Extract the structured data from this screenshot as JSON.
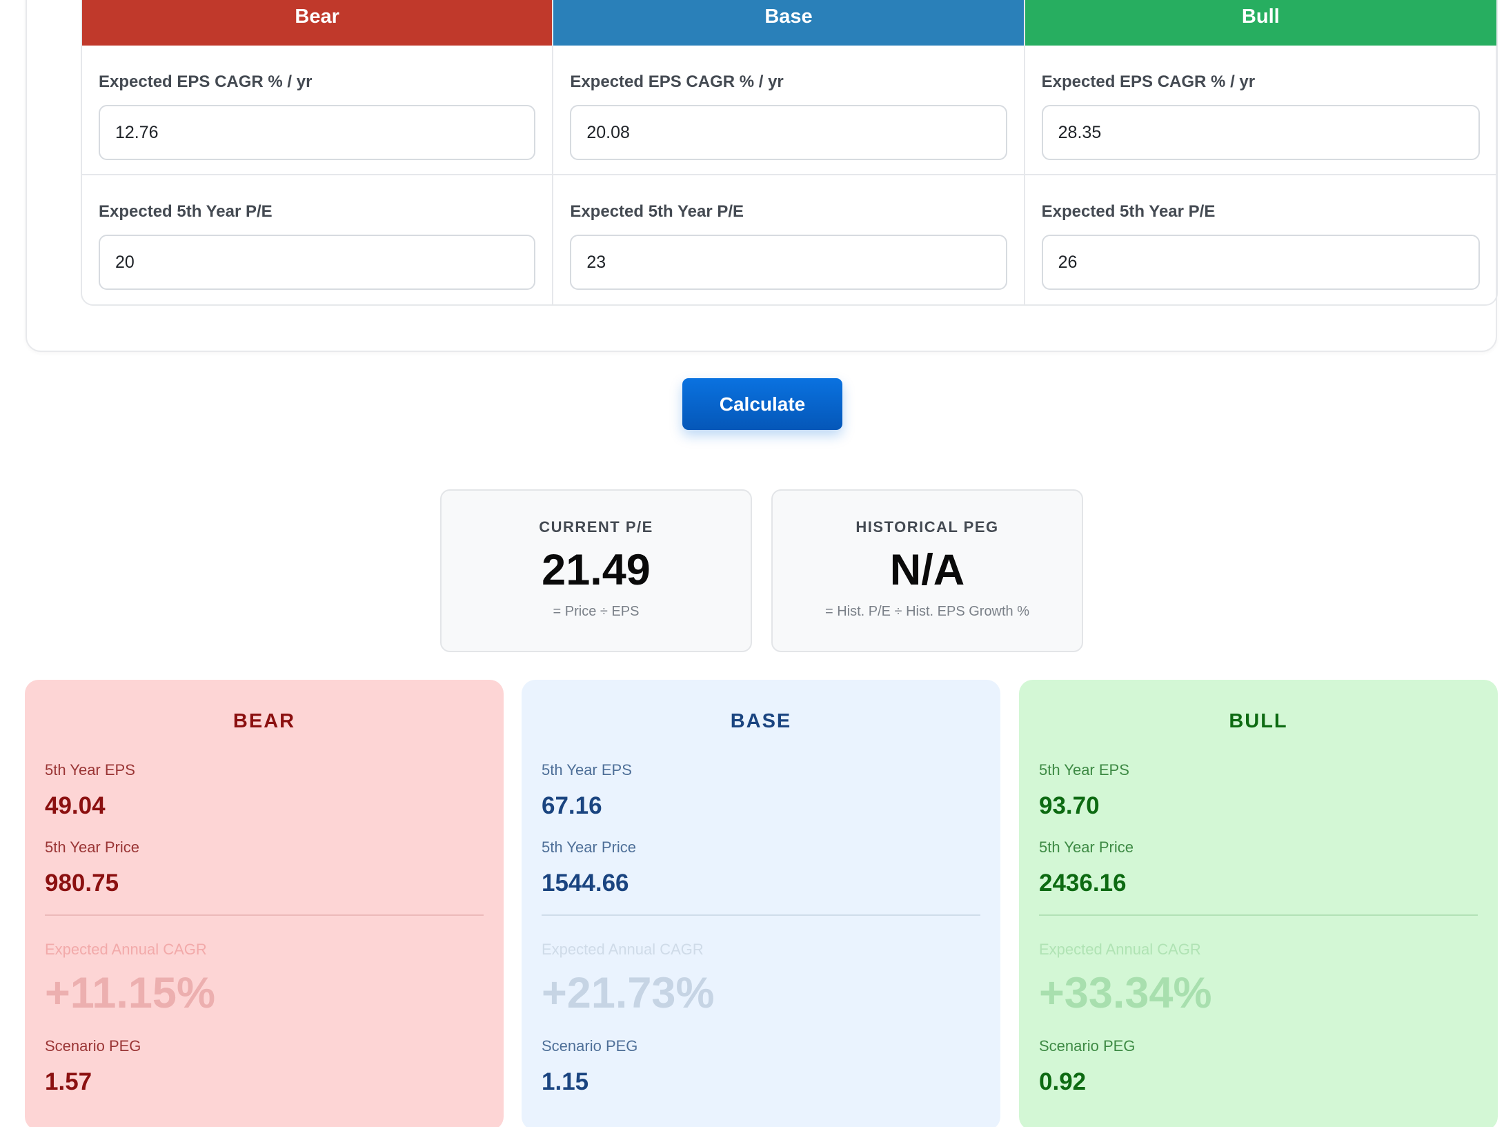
{
  "scenarios": [
    {
      "key": "bear",
      "header": "Bear",
      "cagr_label": "Expected EPS CAGR % / yr",
      "cagr_value": "12.76",
      "pe_label": "Expected 5th Year P/E",
      "pe_value": "20"
    },
    {
      "key": "base",
      "header": "Base",
      "cagr_label": "Expected EPS CAGR % / yr",
      "cagr_value": "20.08",
      "pe_label": "Expected 5th Year P/E",
      "pe_value": "23"
    },
    {
      "key": "bull",
      "header": "Bull",
      "cagr_label": "Expected EPS CAGR % / yr",
      "cagr_value": "28.35",
      "pe_label": "Expected 5th Year P/E",
      "pe_value": "26"
    }
  ],
  "calculate_label": "Calculate",
  "metrics": {
    "current_pe": {
      "title": "CURRENT P/E",
      "value": "21.49",
      "subtitle": "= Price ÷ EPS"
    },
    "historical_peg": {
      "title": "HISTORICAL PEG",
      "value": "N/A",
      "subtitle": "= Hist. P/E ÷ Hist. EPS Growth %"
    }
  },
  "results": [
    {
      "title": "BEAR",
      "eps_label": "5th Year EPS",
      "eps": "49.04",
      "price_label": "5th Year Price",
      "price": "980.75",
      "cagr_label": "Expected Annual CAGR",
      "cagr": "+11.15%",
      "peg_label": "Scenario PEG",
      "peg": "1.57"
    },
    {
      "title": "BASE",
      "eps_label": "5th Year EPS",
      "eps": "67.16",
      "price_label": "5th Year Price",
      "price": "1544.66",
      "cagr_label": "Expected Annual CAGR",
      "cagr": "+21.73%",
      "peg_label": "Scenario PEG",
      "peg": "1.15"
    },
    {
      "title": "BULL",
      "eps_label": "5th Year EPS",
      "eps": "93.70",
      "price_label": "5th Year Price",
      "price": "2436.16",
      "cagr_label": "Expected Annual CAGR",
      "cagr": "+33.34%",
      "peg_label": "Scenario PEG",
      "peg": "0.92"
    }
  ],
  "colors": {
    "bear_header": "#c0392b",
    "base_header": "#2a80b9",
    "bull_header": "#27ae60",
    "button": "#0a72e0"
  }
}
